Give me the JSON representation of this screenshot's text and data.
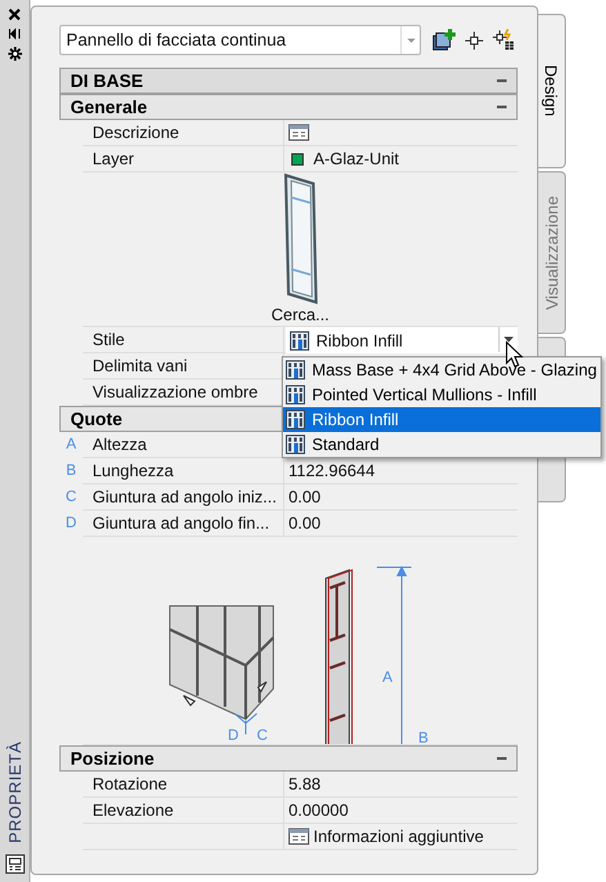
{
  "side_strip": {
    "title": "PROPRIETÀ"
  },
  "object_select": {
    "value": "Pannello di facciata continua"
  },
  "side_tabs": [
    {
      "label": "Design",
      "selected": true
    },
    {
      "label": "Visualizzazione",
      "selected": false
    },
    {
      "selected": false
    }
  ],
  "sections": [
    {
      "title": "DI BASE",
      "kind": "category",
      "expanded": true
    },
    {
      "title": "Generale",
      "kind": "group",
      "expanded": true,
      "rows": [
        {
          "kind": "details",
          "label": "Descrizione"
        },
        {
          "kind": "layer",
          "label": "Layer",
          "value": "A-Glaz-Unit",
          "color": "#00a651"
        },
        {
          "kind": "preview",
          "caption": "Cerca..."
        },
        {
          "kind": "style",
          "label": "Stile",
          "value": "Ribbon Infill"
        },
        {
          "kind": "text",
          "label": "Delimita vani"
        },
        {
          "kind": "text",
          "label": "Visualizzazione ombre"
        }
      ]
    },
    {
      "title": "Quote",
      "kind": "group",
      "rows": [
        {
          "kind": "text",
          "marker": "A",
          "label": "Altezza"
        },
        {
          "kind": "text",
          "marker": "B",
          "label": "Lunghezza",
          "value": "1122.96644"
        },
        {
          "kind": "text",
          "marker": "C",
          "label": "Giuntura ad angolo iniz...",
          "value": "0.00"
        },
        {
          "kind": "text",
          "marker": "D",
          "label": "Giuntura ad angolo fin...",
          "value": "0.00"
        },
        {
          "kind": "diagram",
          "labels": [
            "D",
            "C",
            "A",
            "B"
          ]
        }
      ]
    },
    {
      "title": "Posizione",
      "kind": "group",
      "expanded": true,
      "rows": [
        {
          "kind": "text",
          "label": "Rotazione",
          "value": "5.88"
        },
        {
          "kind": "text",
          "label": "Elevazione",
          "value": "0.00000"
        },
        {
          "kind": "details",
          "value": "Informazioni aggiuntive"
        }
      ]
    }
  ],
  "style_dropdown": {
    "items": [
      {
        "label": "Mass Base + 4x4 Grid Above - Glazing",
        "selected": false
      },
      {
        "label": "Pointed Vertical Mullions - Infill",
        "selected": false
      },
      {
        "label": "Ribbon Infill",
        "selected": true
      },
      {
        "label": "Standard",
        "selected": false
      }
    ]
  }
}
